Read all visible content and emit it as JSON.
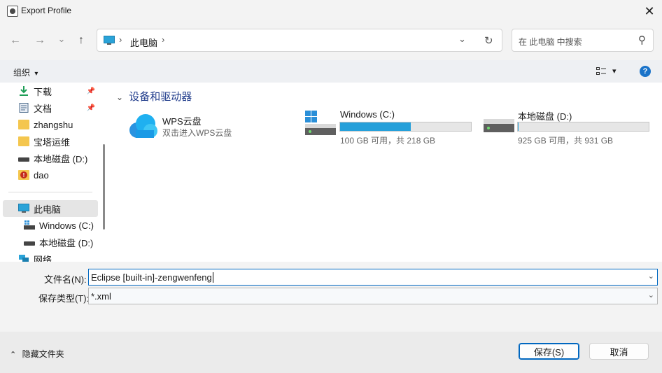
{
  "window": {
    "title": "Export Profile",
    "close_glyph": "✕"
  },
  "nav": {
    "back_glyph": "←",
    "forward_glyph": "→",
    "recent_glyph": "⌄",
    "up_glyph": "↑",
    "breadcrumb_sep": "›",
    "breadcrumb": [
      "此电脑"
    ],
    "dropdown_glyph": "⌄",
    "refresh_glyph": "↻"
  },
  "search": {
    "placeholder": "在 此电脑 中搜索",
    "icon_glyph": "⚲"
  },
  "toolbar": {
    "organize_label": "组织",
    "dropdown_glyph": "▾",
    "help_glyph": "?"
  },
  "sidebar": {
    "items": [
      {
        "label": "下载",
        "icon": "download-icon",
        "pinned": true
      },
      {
        "label": "文档",
        "icon": "document-icon",
        "pinned": true
      },
      {
        "label": "zhangshu",
        "icon": "folder-icon",
        "pinned": false
      },
      {
        "label": "宝塔运维",
        "icon": "folder-icon",
        "pinned": false
      },
      {
        "label": "本地磁盘 (D:)",
        "icon": "drive-icon",
        "pinned": false
      },
      {
        "label": "dao",
        "icon": "folder-warning-icon",
        "pinned": false
      },
      {
        "label": "此电脑",
        "icon": "computer-icon",
        "pinned": false,
        "selected": true
      },
      {
        "label": "Windows (C:)",
        "icon": "windows-drive-icon",
        "pinned": false,
        "indent": true
      },
      {
        "label": "本地磁盘 (D:)",
        "icon": "drive-icon",
        "pinned": false,
        "indent": true
      },
      {
        "label": "网络",
        "icon": "network-icon",
        "pinned": false
      }
    ],
    "pin_glyph": "📌"
  },
  "content": {
    "group_header": "设备和驱动器",
    "group_chevron": "⌄",
    "items": [
      {
        "name": "WPS云盘",
        "subtitle": "双击进入WPS云盘",
        "icon": "cloud-icon"
      },
      {
        "name": "Windows (C:)",
        "subtitle": "100 GB 可用，共 218 GB",
        "icon": "windows-drive-icon",
        "used_fraction": 0.54
      },
      {
        "name": "本地磁盘 (D:)",
        "subtitle": "925 GB 可用，共 931 GB",
        "icon": "drive-icon",
        "used_fraction": 0.006
      }
    ]
  },
  "form": {
    "filename_label": "文件名(N):",
    "filename_value": "Eclipse [built-in]-zengwenfeng",
    "filetype_label": "保存类型(T):",
    "filetype_value": "*.xml",
    "dropdown_glyph": "⌄"
  },
  "footer": {
    "hide_folders_label": "隐藏文件夹",
    "hide_glyph": "⌃",
    "save_label": "保存(S)",
    "cancel_label": "取消"
  },
  "colors": {
    "accent": "#0067c0",
    "bar_fill": "#26a0da",
    "header_blue": "#1e3a8a"
  }
}
